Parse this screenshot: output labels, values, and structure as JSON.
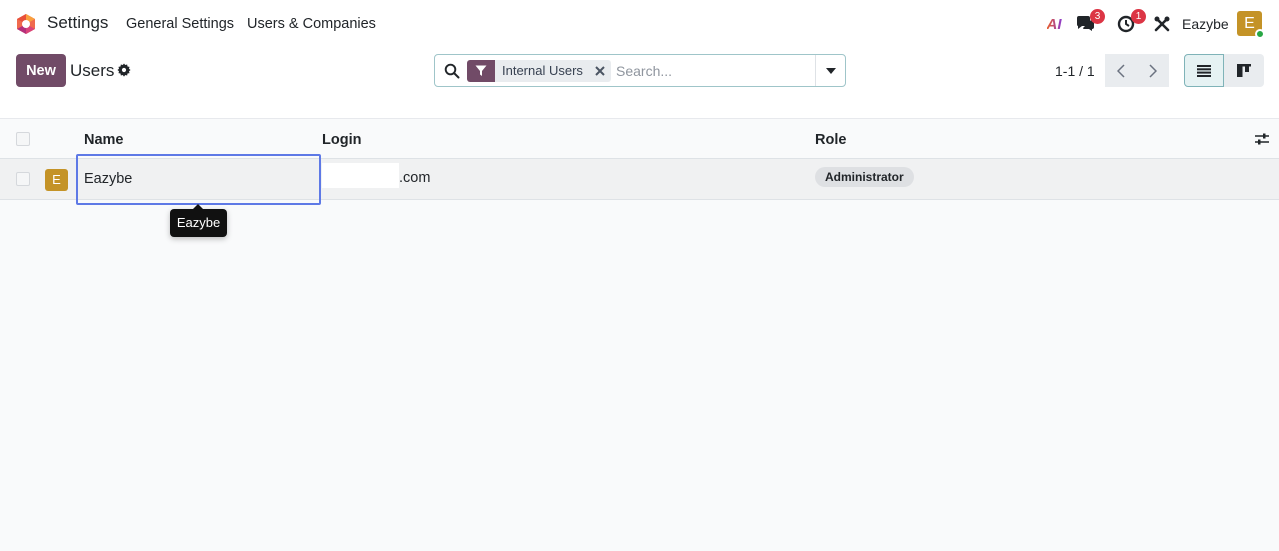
{
  "navbar": {
    "app_name": "Settings",
    "menu": [
      "General Settings",
      "Users & Companies"
    ],
    "systray": {
      "ai_label": "AI",
      "messages_count": "3",
      "activities_count": "1",
      "user_name": "Eazybe",
      "user_initial": "E"
    }
  },
  "control_panel": {
    "new_label": "New",
    "breadcrumb": "Users",
    "search": {
      "facet_label": "Internal Users",
      "placeholder": "Search..."
    },
    "pager": "1-1 / 1"
  },
  "list": {
    "columns": [
      "Name",
      "Login",
      "Role"
    ],
    "rows": [
      {
        "initial": "E",
        "name": "Eazybe",
        "login_visible": ".com",
        "role": "Administrator"
      }
    ]
  },
  "tooltip": {
    "text": "Eazybe"
  },
  "colors": {
    "brand": "#714b67",
    "focus": "#5e79e6",
    "avatar": "#c49327",
    "badge": "#dc3545"
  }
}
